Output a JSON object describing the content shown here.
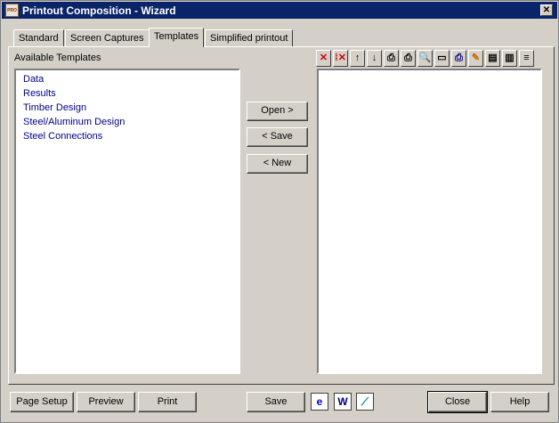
{
  "window": {
    "title": "Printout Composition - Wizard",
    "close_glyph": "✕",
    "app_icon_text": "PRO"
  },
  "tabs": [
    {
      "label": "Standard",
      "active": false
    },
    {
      "label": "Screen Captures",
      "active": false
    },
    {
      "label": "Templates",
      "active": true
    },
    {
      "label": "Simplified printout",
      "active": false
    }
  ],
  "available_templates": {
    "label": "Available Templates",
    "items": [
      "Data",
      "Results",
      "Timber Design",
      "Steel/Aluminum Design",
      "Steel Connections"
    ]
  },
  "middle_buttons": {
    "open": "Open >",
    "save": "< Save",
    "new": "< New"
  },
  "toolbar": {
    "icons": [
      {
        "name": "delete-icon",
        "glyph": "✕",
        "color": "#cc0000"
      },
      {
        "name": "delete-all-icon",
        "glyph": "⁞✕",
        "color": "#cc0000"
      },
      {
        "name": "move-up-icon",
        "glyph": "↑",
        "color": "#000000"
      },
      {
        "name": "move-down-icon",
        "glyph": "↓",
        "color": "#000000"
      },
      {
        "name": "print-selected-icon",
        "glyph": "⎙",
        "color": "#000000"
      },
      {
        "name": "print-remove-icon",
        "glyph": "⎙",
        "color": "#000000"
      },
      {
        "name": "preview-icon",
        "glyph": "🔍",
        "color": "#000080"
      },
      {
        "name": "page-setup-icon",
        "glyph": "▭",
        "color": "#000000"
      },
      {
        "name": "printer-icon",
        "glyph": "⎙",
        "color": "#000080"
      },
      {
        "name": "edit-icon",
        "glyph": "✎",
        "color": "#cc6600"
      },
      {
        "name": "save-layout-icon",
        "glyph": "▤",
        "color": "#000000"
      },
      {
        "name": "layout-icon",
        "glyph": "▥",
        "color": "#000000"
      },
      {
        "name": "text-list-icon",
        "glyph": "≡",
        "color": "#000000"
      }
    ]
  },
  "bottom_buttons": {
    "page_setup": "Page Setup",
    "preview": "Preview",
    "print": "Print",
    "save": "Save",
    "close": "Close",
    "help": "Help"
  },
  "export_icons": [
    {
      "name": "ie-export-icon",
      "glyph": "e",
      "color": "#0000cc"
    },
    {
      "name": "word-export-icon",
      "glyph": "W",
      "color": "#000080"
    },
    {
      "name": "excel-export-icon",
      "glyph": "⟋",
      "color": "#008080"
    }
  ]
}
